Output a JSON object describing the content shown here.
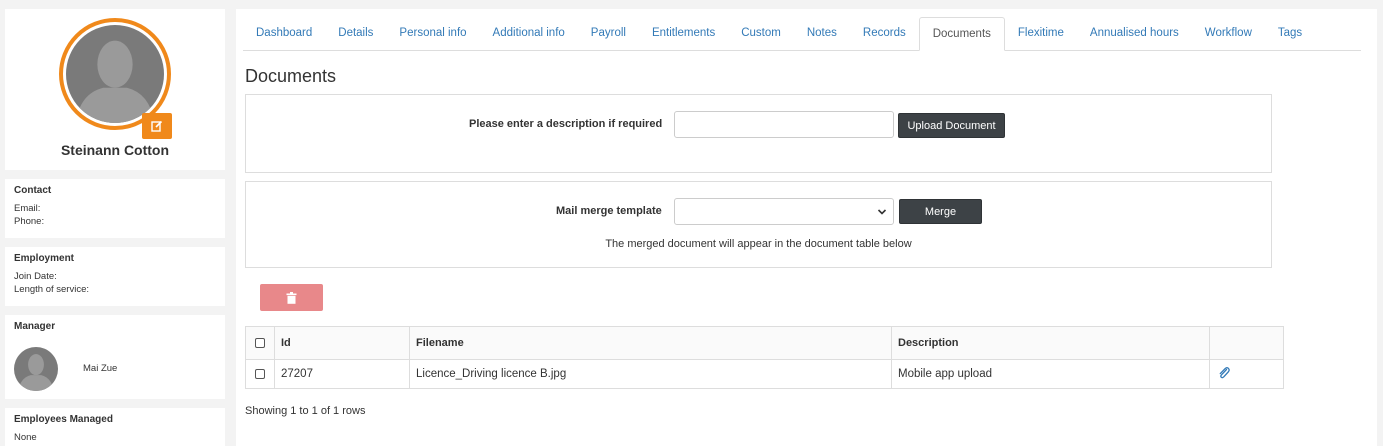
{
  "profile": {
    "name": "Steinann Cotton"
  },
  "contact": {
    "title": "Contact",
    "email_label": "Email:",
    "phone_label": "Phone:"
  },
  "employment": {
    "title": "Employment",
    "join_label": "Join Date:",
    "service_label": "Length of service:"
  },
  "manager": {
    "title": "Manager",
    "name": "Mai Zue"
  },
  "managed": {
    "title": "Employees Managed",
    "value": "None"
  },
  "tabs": [
    {
      "label": "Dashboard"
    },
    {
      "label": "Details"
    },
    {
      "label": "Personal info"
    },
    {
      "label": "Additional info"
    },
    {
      "label": "Payroll"
    },
    {
      "label": "Entitlements"
    },
    {
      "label": "Custom"
    },
    {
      "label": "Notes"
    },
    {
      "label": "Records"
    },
    {
      "label": "Documents"
    },
    {
      "label": "Flexitime"
    },
    {
      "label": "Annualised hours"
    },
    {
      "label": "Workflow"
    },
    {
      "label": "Tags"
    }
  ],
  "page": {
    "title": "Documents"
  },
  "upload": {
    "label": "Please enter a description if required",
    "description_value": "",
    "button_label": "Upload Document"
  },
  "merge": {
    "label": "Mail merge template",
    "selected_value": "",
    "button_label": "Merge",
    "note": "The merged document will appear in the document table below"
  },
  "table": {
    "headers": {
      "id": "Id",
      "filename": "Filename",
      "description": "Description"
    },
    "rows": [
      {
        "id": "27207",
        "filename": "Licence_Driving licence B.jpg",
        "description": "Mobile app upload"
      }
    ],
    "footer": "Showing 1 to 1 of 1 rows"
  },
  "colors": {
    "accent": "#f0891b",
    "link": "#337ab7",
    "dark_button": "#3d4246",
    "danger_button": "#e8888a"
  },
  "icons": [
    "edit-icon",
    "trash-icon",
    "paperclip-icon",
    "chevron-down-icon",
    "person-silhouette-icon"
  ]
}
